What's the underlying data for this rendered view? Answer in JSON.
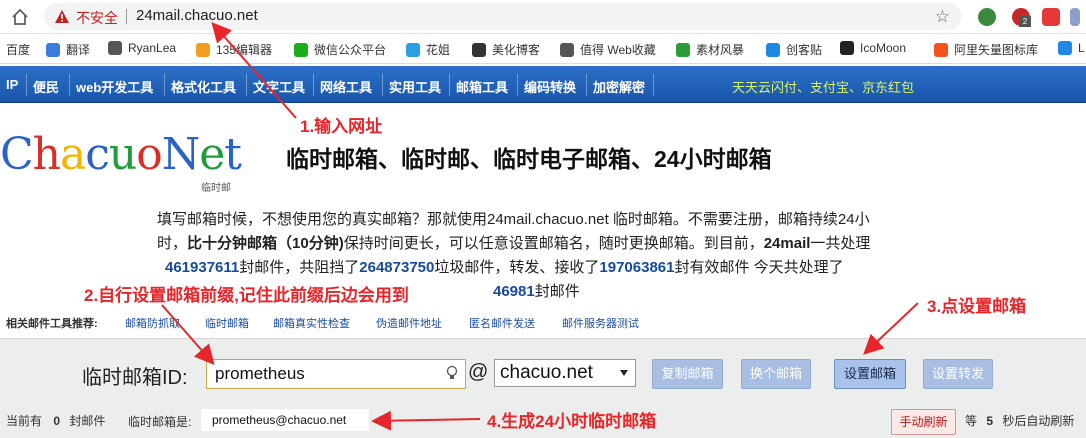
{
  "browser": {
    "not_secure": "不安全",
    "url": "24mail.chacuo.net",
    "ext_badge": "2"
  },
  "bookmarks": [
    {
      "label": "百度",
      "color": ""
    },
    {
      "label": "翻译",
      "color": "#3b7ddd"
    },
    {
      "label": "RyanLea",
      "color": "#555555"
    },
    {
      "label": "135编辑器",
      "color": "#f0a020"
    },
    {
      "label": "微信公众平台",
      "color": "#1aad19"
    },
    {
      "label": "花姐",
      "color": "#2aa0e0"
    },
    {
      "label": "美化博客",
      "color": "#333333"
    },
    {
      "label": "值得 Web收藏",
      "color": "#555555"
    },
    {
      "label": "素材风暴",
      "color": "#2a9d3a"
    },
    {
      "label": "创客贴",
      "color": "#1e88e5"
    },
    {
      "label": "IcoMoon",
      "color": "#222222"
    },
    {
      "label": "阿里矢量图标库",
      "color": "#f4511e"
    },
    {
      "label": "L",
      "color": "#1e88e5"
    }
  ],
  "nav": {
    "items": [
      "IP",
      "便民",
      "web开发工具",
      "格式化工具",
      "文字工具",
      "网络工具",
      "实用工具",
      "邮箱工具",
      "编码转换",
      "加密解密"
    ],
    "slogan": "天天云闪付、支付宝、京东红包"
  },
  "logo": {
    "letters": [
      "C",
      "h",
      "a",
      "c",
      "u",
      "o",
      "N",
      "e",
      "t"
    ],
    "colors": [
      "#2a63c8",
      "#d93025",
      "#f4b400",
      "#2a63c8",
      "#1e9e3a",
      "#d93025",
      "#2a63c8",
      "#1e9e3a",
      "#2a63c8"
    ],
    "subtitle": "临时邮"
  },
  "page": {
    "title": "临时邮箱、临时邮、临时电子邮箱、24小时邮箱"
  },
  "intro": {
    "l1": "填写邮箱时候，不想使用您的真实邮箱？那就使用24mail.chacuo.net 临时邮箱。不需要注册，邮箱持续24小",
    "l2a": "时，",
    "l2b": "比十分钟邮箱（10分钟)",
    "l2c": "保持时间更长，可以任意设置邮箱名，随时更换邮箱。到目前，",
    "l2d": "24mail",
    "l2e": "一共处理",
    "l3a": "461937611",
    "l3b": "封邮件，共阻挡了",
    "l3c": "264873750",
    "l3d": "垃圾邮件，转发、接收了",
    "l3e": "197063861",
    "l3f": "封有效邮件 今天共处理了",
    "l4a": "46981",
    "l4b": "封邮件"
  },
  "related": {
    "label": "相关邮件工具推荐:",
    "links": [
      "邮箱防抓取",
      "临时邮箱",
      "邮箱真实性检查",
      "伪造邮件地址",
      "匿名邮件发送",
      "邮件服务器测试"
    ]
  },
  "mail": {
    "label": "临时邮箱ID:",
    "prefix": "prometheus",
    "at": "@",
    "domain": "chacuo.net",
    "buttons": [
      "复制邮箱",
      "换个邮箱",
      "设置邮箱",
      "设置转发"
    ],
    "current_prefix": "当前有",
    "current_count": "0",
    "current_suffix": "封邮件",
    "address_label": "临时邮箱是:",
    "address": "prometheus@chacuo.net",
    "refresh": "手动刷新",
    "wait_prefix": "等",
    "wait_seconds": "5",
    "wait_suffix": "秒后自动刷新"
  },
  "annotations": {
    "step1": "1.输入网址",
    "step2": "2.自行设置邮箱前缀,记住此前缀后边会用到",
    "step3": "3.点设置邮箱",
    "step4": "4.生成24小时临时邮箱",
    "color": "#e6262a"
  }
}
